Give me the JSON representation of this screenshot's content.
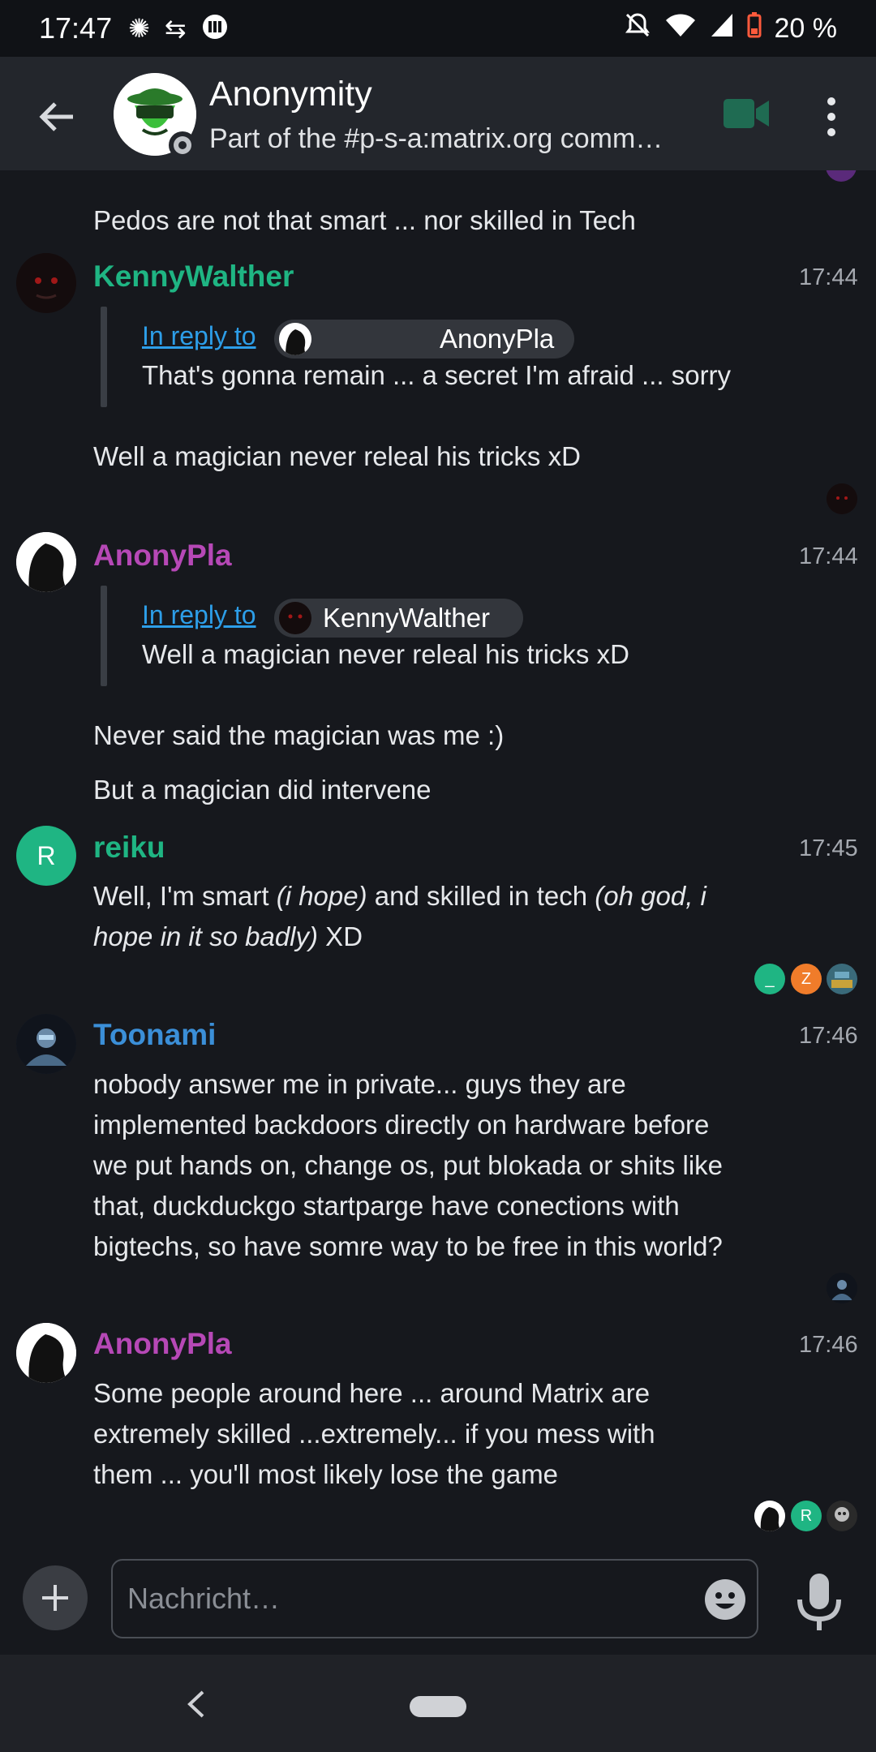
{
  "status_bar": {
    "time": "17:47",
    "battery": "20 %"
  },
  "header": {
    "title": "Anonymity",
    "subtitle": "Part of the #p-s-a:matrix.org comm…"
  },
  "messages": {
    "m0": {
      "text": "Pedos are not that smart ... nor skilled in Tech"
    },
    "m1": {
      "sender": "KennyWalther",
      "time": "17:44",
      "reply_link": "In reply to",
      "reply_user": "AnonyPla",
      "reply_text": "That's gonna remain ... a secret I'm afraid ... sorry",
      "text": "Well a magician never releal his tricks xD"
    },
    "m2": {
      "sender": "AnonyPla",
      "time": "17:44",
      "reply_link": "In reply to",
      "reply_user": "KennyWalther",
      "reply_text": "Well a magician never releal his tricks xD",
      "text1": "Never said the magician was me :)",
      "text2": "But a magician did intervene"
    },
    "m3": {
      "sender": "reiku",
      "avatar_letter": "R",
      "time": "17:45",
      "t1": "Well, I'm smart ",
      "t2": "(i hope)",
      "t3": " and skilled in tech ",
      "t4": "(oh god, i",
      "t5": "hope in it so badly)",
      "t6": " XD",
      "receipts": [
        "_",
        "Z"
      ]
    },
    "m4": {
      "sender": "Toonami",
      "time": "17:46",
      "lines": [
        "nobody answer me in private... guys they are",
        "implemented backdoors directly on hardware before",
        "we put hands on, change os, put blokada or shits like",
        "that, duckduckgo startparge have conections with",
        "bigtechs, so have somre way to be free in this world?"
      ]
    },
    "m5": {
      "sender": "AnonyPla",
      "time": "17:46",
      "lines": [
        "Some people around here ... around Matrix are",
        "extremely skilled ...extremely... if you mess with",
        "them ... you'll most likely lose the game"
      ],
      "receipt_letter": "R"
    }
  },
  "composer": {
    "placeholder": "Nachricht…"
  },
  "colors": {
    "kenny": "#1fb583",
    "anonypla": "#b648b6",
    "reiku": "#1fb583",
    "toonami": "#3b8fd8",
    "link": "#2d9ee8"
  }
}
